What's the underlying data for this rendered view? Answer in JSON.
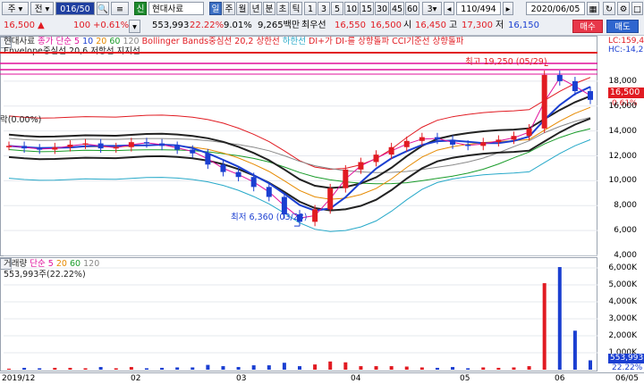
{
  "toolbar": {
    "mode_label": "주",
    "jeon_label": "전",
    "code_value": "016/50",
    "new_label": "신",
    "stock_name": "현대사료",
    "period_d": "일",
    "period_w": "주",
    "period_m": "월",
    "period_y": "년",
    "period_min": "분",
    "period_s": "초",
    "period_t": "틱",
    "intervals": [
      "1",
      "3",
      "5",
      "10",
      "15",
      "30",
      "45",
      "60"
    ],
    "interval_3": "3",
    "count_value": "110/494",
    "date_value": "2020/06/05",
    "buy_label": "매수",
    "sell_label": "매도"
  },
  "quote": {
    "price": "16,500",
    "change_arrow": "▲",
    "change": "100",
    "change_pct": "+0.61%",
    "volume": "553,993",
    "vol_ratio": "22.22%",
    "turnover": "9.01%",
    "amount": "9,265백만",
    "low_label": "최우선",
    "bid1": "16,550",
    "bid2": "16,500",
    "open_label": "시",
    "open": "16,450",
    "high_label": "고",
    "high": "17,300",
    "low2_label": "저",
    "low": "16,150"
  },
  "price_panel": {
    "legend1_name": "현대사료",
    "legend1_ma": "종가 단순",
    "ma5": "5",
    "ma10": "10",
    "ma20": "20",
    "ma60": "60",
    "ma120": "120",
    "legend1_bb": "Bollinger Bands중심선 20,2",
    "legend1_up": "상한선",
    "legend1_low": "하한선",
    "legend1_di": "DI+가 DI-를 상향돌파",
    "legend1_cci": "CCI기준선 상향돌파",
    "legend2": "Envelope중심선 20,6",
    "legend2_b": "저항선",
    "legend2_c": "지지선",
    "left_note": "락(0.00%)",
    "high_annot": "최고 19,250 (05/29)",
    "low_annot": "최저 6,360 (03/23)",
    "lc_label": "LC:159,4",
    "hc_label": "HC:-14,2",
    "last_price": "16,500",
    "last_pct": "0.61%",
    "y_ticks": [
      "18,000",
      "16,000",
      "14,000",
      "12,000",
      "10,000",
      "8,000",
      "6,000",
      "4,000"
    ]
  },
  "volume_panel": {
    "title": "거래량",
    "ma": "단순",
    "ma5": "5",
    "ma20": "20",
    "ma60": "60",
    "ma120": "120",
    "value_line": "553,993주(22.22%)",
    "last_vol": "553,993",
    "last_pct": "22.22%",
    "y_ticks": [
      "6,000K",
      "5,000K",
      "4,000K",
      "3,000K",
      "2,000K",
      "1,000K"
    ]
  },
  "x_axis": [
    "2019/12",
    "02",
    "03",
    "04",
    "05",
    "06",
    "06/05"
  ],
  "colors": {
    "up": "#e11b22",
    "down": "#1b3fd1",
    "ma5": "#e0119b",
    "ma10": "#1b3fd1",
    "ma20": "#e68a00",
    "ma60": "#1a9c2a",
    "ma120": "#8a8a8a",
    "bb": "#e11b22",
    "env": "#222222"
  },
  "chart_data": {
    "type": "line",
    "title": "",
    "ylim": [
      4000,
      19500
    ],
    "series": [
      {
        "name": "현대사료",
        "values": [
          12800,
          12600,
          12500,
          12700,
          12900,
          13000,
          12600,
          12700,
          13100,
          13000,
          12800,
          12500,
          12200,
          11300,
          10700,
          10300,
          9500,
          8700,
          7300,
          6700,
          7700,
          9400,
          10900,
          11500,
          12100,
          12700,
          13200,
          13500,
          13300,
          12900,
          12800,
          13100,
          13300,
          13600,
          14200,
          18500,
          18000,
          17200,
          16500
        ]
      }
    ]
  }
}
